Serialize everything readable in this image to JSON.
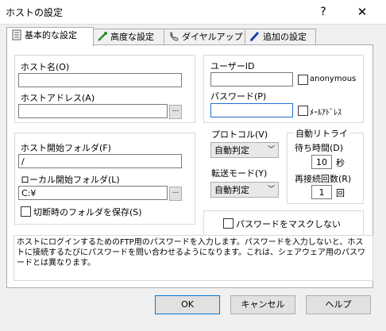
{
  "window": {
    "title": "ホストの設定",
    "help": "?",
    "close": "✕"
  },
  "tabs": [
    {
      "label": "基本的な設定",
      "icon": "document-icon",
      "active": true
    },
    {
      "label": "高度な設定",
      "icon": "wrench-icon",
      "active": false
    },
    {
      "label": "ダイヤルアップ",
      "icon": "phone-icon",
      "active": false
    },
    {
      "label": "追加の設定",
      "icon": "pen-icon",
      "active": false
    }
  ],
  "host": {
    "name_label": "ホスト名(O)",
    "name_value": "",
    "address_label": "ホストアドレス(A)",
    "address_value": "",
    "browse": "..."
  },
  "user": {
    "id_label": "ユーザーID",
    "id_value": "",
    "anonymous_label": "anonymous",
    "anonymous_checked": false,
    "password_label": "パスワード(P)",
    "password_value": "",
    "mail_label": "ﾒｰﾙｱﾄﾞﾚｽ",
    "mail_checked": false
  },
  "folders": {
    "host_label": "ホスト開始フォルダ(F)",
    "host_value": "/",
    "local_label": "ローカル開始フォルダ(L)",
    "local_value": "C:¥",
    "browse": "...",
    "save_label": "切断時のフォルダを保存(S)",
    "save_checked": false
  },
  "protocol": {
    "label": "プロトコル(V)",
    "value": "自動判定"
  },
  "transfer": {
    "label": "転送モード(Y)",
    "value": "自動判定"
  },
  "retry": {
    "title": "自動リトライ",
    "wait_label": "待ち時間(D)",
    "wait_value": "10",
    "wait_unit": "秒",
    "count_label": "再接続回数(R)",
    "count_value": "1",
    "count_unit": "回"
  },
  "mask": {
    "label": "パスワードをマスクしない",
    "checked": false
  },
  "description": "ホストにログインするためのFTP用のパスワードを入力します。パスワードを入力しないと、ホストに接続するたびにパスワードを問い合わせるようになります。これは、シェアウェア用のパスワードとは異なります。",
  "buttons": {
    "ok": "OK",
    "cancel": "キャンセル",
    "help": "ヘルプ"
  },
  "colors": {
    "focus_border": "#1e6fd0",
    "default_button_border": "#0078d7"
  }
}
